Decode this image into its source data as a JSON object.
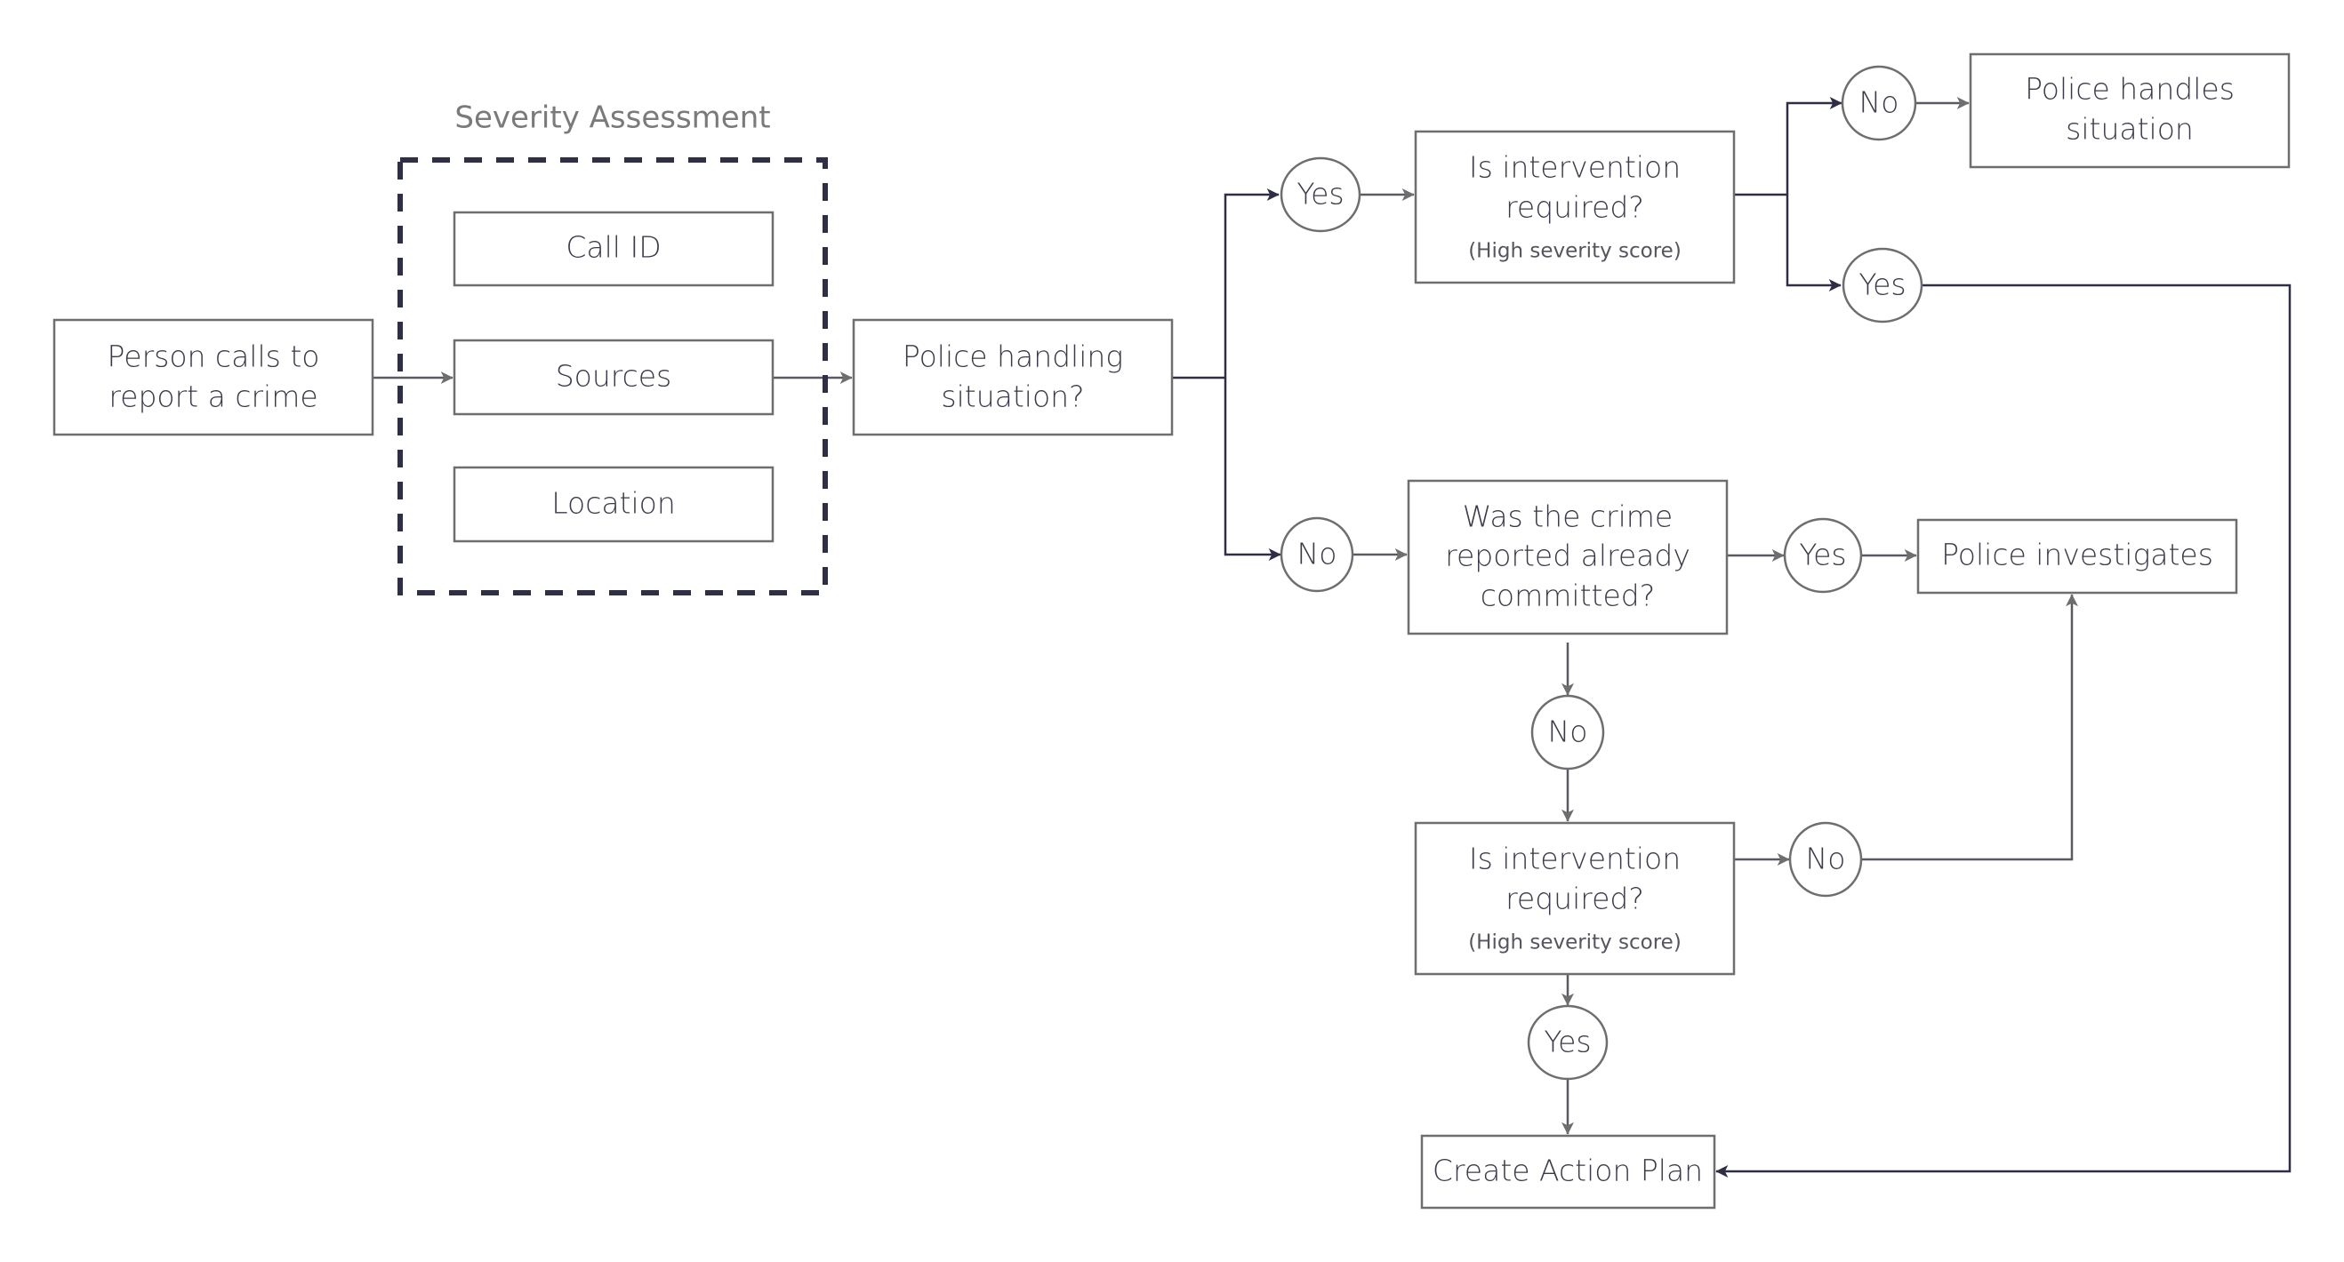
{
  "diagram": {
    "group_label": "Severity Assessment",
    "nodes": {
      "person_calls": [
        "Person calls to",
        "report a crime"
      ],
      "call_id": "Call ID",
      "sources": "Sources",
      "location": "Location",
      "police_handling": [
        "Police handling",
        "situation?"
      ],
      "intervention_top": [
        "Is intervention",
        "required?",
        "(High severity score)"
      ],
      "police_handles": [
        "Police handles",
        "situation"
      ],
      "crime_committed": [
        "Was the crime",
        "reported already",
        "committed?"
      ],
      "police_investigates": "Police investigates",
      "intervention_bottom": [
        "Is intervention",
        "required?",
        "(High severity score)"
      ],
      "create_action_plan": "Create Action Plan"
    },
    "decisions": {
      "handling_yes": "Yes",
      "handling_no": "No",
      "top_no": "No",
      "top_yes": "Yes",
      "committed_yes": "Yes",
      "committed_no": "No",
      "bottom_no": "No",
      "bottom_yes": "Yes"
    },
    "colors": {
      "box_stroke": "#6e6e6e",
      "connector_dark": "#2e2f45",
      "connector_gray": "#6e6e6e",
      "text": "#3a3a4a"
    }
  }
}
